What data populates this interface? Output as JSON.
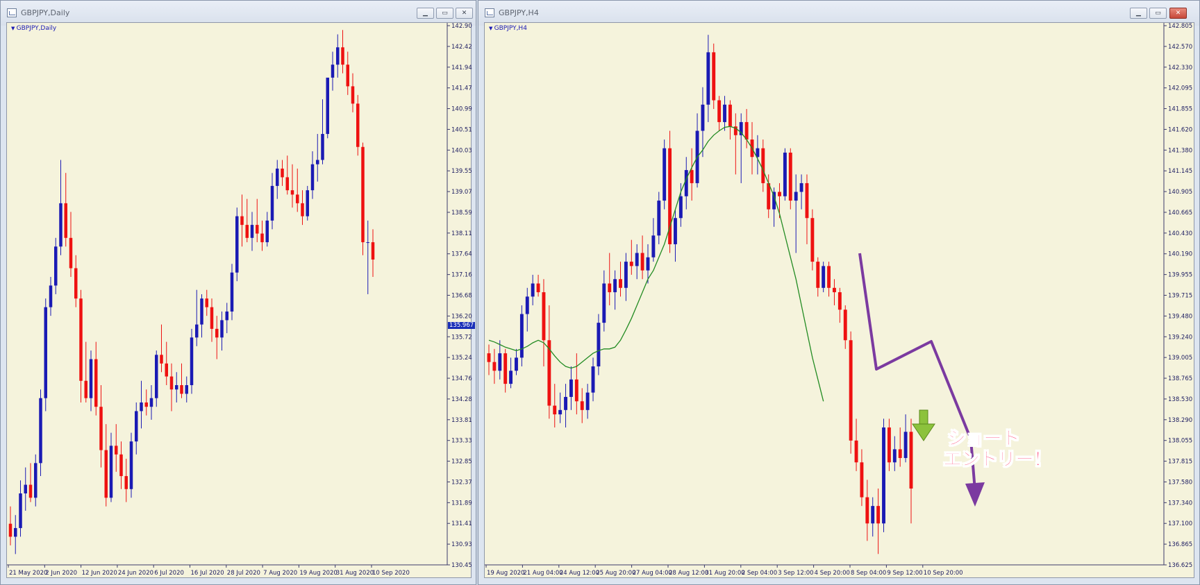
{
  "left_window": {
    "title": "GBPJPY,Daily",
    "symbol_label": "GBPJPY,Daily",
    "current_price": "135.967",
    "buttons": [
      "minimize",
      "maximize",
      "close"
    ]
  },
  "right_window": {
    "title": "GBPJPY,H4",
    "symbol_label": "GBPJPY,H4",
    "buttons": [
      "minimize",
      "maximize",
      "close"
    ],
    "annotation_line1": "ショート",
    "annotation_line2": "エントリー！"
  },
  "colors": {
    "bull": "#1a1ab4",
    "bear": "#ee1111",
    "ma": "#228b22",
    "annotation_arrow": "#7b3aa0",
    "down_arrow": "#8cc23c",
    "background": "#f5f3dc"
  },
  "chart_data": [
    {
      "type": "candlestick",
      "title": "GBPJPY,Daily",
      "ylim": [
        130.45,
        142.9
      ],
      "y_ticks": [
        "142.900",
        "142.420",
        "141.940",
        "141.470",
        "140.990",
        "140.510",
        "140.030",
        "139.550",
        "139.070",
        "138.590",
        "138.110",
        "137.640",
        "137.160",
        "136.680",
        "136.200",
        "135.720",
        "135.240",
        "134.760",
        "134.280",
        "133.810",
        "133.330",
        "132.850",
        "132.370",
        "131.890",
        "131.410",
        "130.930",
        "130.450"
      ],
      "x_ticks": [
        "21 May 2020",
        "2 Jun 2020",
        "12 Jun 2020",
        "24 Jun 2020",
        "6 Jul 2020",
        "16 Jul 2020",
        "28 Jul 2020",
        "7 Aug 2020",
        "19 Aug 2020",
        "31 Aug 2020",
        "10 Sep 2020"
      ],
      "candles": [
        [
          131.4,
          131.8,
          130.9,
          131.1
        ],
        [
          131.1,
          131.6,
          130.7,
          131.3
        ],
        [
          131.3,
          132.4,
          131.1,
          132.1
        ],
        [
          132.1,
          132.7,
          131.7,
          132.3
        ],
        [
          132.3,
          132.8,
          131.9,
          132.0
        ],
        [
          132.0,
          133.0,
          131.8,
          132.8
        ],
        [
          132.8,
          134.5,
          132.5,
          134.3
        ],
        [
          134.3,
          136.6,
          134.0,
          136.4
        ],
        [
          136.4,
          137.1,
          136.2,
          136.9
        ],
        [
          136.9,
          138.0,
          136.7,
          137.8
        ],
        [
          137.8,
          139.8,
          137.6,
          138.8
        ],
        [
          138.8,
          139.5,
          137.8,
          138.0
        ],
        [
          138.0,
          138.6,
          137.1,
          137.3
        ],
        [
          137.3,
          137.6,
          136.4,
          136.6
        ],
        [
          136.6,
          136.8,
          134.2,
          134.7
        ],
        [
          134.7,
          135.6,
          134.2,
          134.3
        ],
        [
          134.3,
          135.4,
          134.0,
          135.2
        ],
        [
          135.2,
          135.6,
          133.9,
          134.1
        ],
        [
          134.1,
          134.6,
          132.7,
          133.1
        ],
        [
          133.1,
          133.7,
          131.8,
          132.0
        ],
        [
          132.0,
          133.5,
          131.9,
          133.2
        ],
        [
          133.2,
          133.7,
          132.6,
          133.0
        ],
        [
          133.0,
          133.3,
          132.2,
          132.5
        ],
        [
          132.5,
          132.9,
          131.9,
          132.2
        ],
        [
          132.2,
          133.5,
          132.0,
          133.3
        ],
        [
          133.3,
          134.2,
          133.0,
          134.0
        ],
        [
          134.0,
          134.7,
          133.6,
          134.2
        ],
        [
          134.2,
          134.5,
          133.9,
          134.1
        ],
        [
          134.1,
          134.6,
          133.8,
          134.3
        ],
        [
          134.3,
          135.4,
          134.1,
          135.3
        ],
        [
          135.3,
          136.0,
          134.9,
          135.1
        ],
        [
          135.1,
          135.6,
          134.6,
          134.8
        ],
        [
          134.8,
          135.1,
          134.0,
          134.5
        ],
        [
          134.5,
          134.9,
          134.2,
          134.6
        ],
        [
          134.6,
          135.1,
          134.3,
          134.4
        ],
        [
          134.4,
          134.8,
          134.2,
          134.6
        ],
        [
          134.6,
          135.9,
          134.4,
          135.7
        ],
        [
          135.7,
          136.8,
          135.5,
          136.0
        ],
        [
          136.0,
          136.7,
          135.7,
          136.6
        ],
        [
          136.6,
          136.8,
          136.2,
          136.4
        ],
        [
          136.4,
          136.6,
          135.6,
          135.9
        ],
        [
          135.9,
          136.2,
          135.2,
          135.7
        ],
        [
          135.7,
          136.3,
          135.4,
          136.1
        ],
        [
          136.1,
          136.5,
          135.8,
          136.3
        ],
        [
          136.3,
          137.4,
          136.1,
          137.2
        ],
        [
          137.2,
          138.7,
          137.0,
          138.5
        ],
        [
          138.5,
          139.0,
          137.8,
          138.3
        ],
        [
          138.3,
          138.9,
          137.9,
          138.0
        ],
        [
          138.0,
          138.6,
          137.7,
          138.3
        ],
        [
          138.3,
          138.9,
          137.9,
          138.1
        ],
        [
          138.1,
          138.4,
          137.7,
          137.9
        ],
        [
          137.9,
          138.6,
          137.8,
          138.4
        ],
        [
          138.4,
          139.5,
          138.2,
          139.2
        ],
        [
          139.2,
          139.8,
          138.9,
          139.6
        ],
        [
          139.6,
          139.8,
          139.2,
          139.4
        ],
        [
          139.4,
          139.9,
          139.0,
          139.1
        ],
        [
          139.1,
          139.7,
          138.7,
          139.0
        ],
        [
          139.0,
          139.6,
          138.6,
          138.8
        ],
        [
          138.8,
          139.1,
          138.3,
          138.5
        ],
        [
          138.5,
          139.2,
          138.4,
          139.1
        ],
        [
          139.1,
          140.0,
          138.9,
          139.7
        ],
        [
          139.7,
          140.4,
          139.3,
          139.8
        ],
        [
          139.8,
          141.2,
          139.7,
          140.4
        ],
        [
          140.4,
          141.6,
          140.3,
          141.7
        ],
        [
          141.7,
          142.3,
          141.4,
          142.0
        ],
        [
          142.0,
          142.7,
          141.7,
          142.4
        ],
        [
          142.4,
          142.8,
          141.8,
          142.0
        ],
        [
          142.0,
          142.3,
          141.3,
          141.5
        ],
        [
          141.5,
          141.8,
          140.9,
          141.1
        ],
        [
          141.1,
          141.3,
          139.9,
          140.1
        ],
        [
          140.1,
          140.2,
          137.6,
          137.9
        ],
        [
          137.9,
          138.4,
          136.7,
          137.9
        ],
        [
          137.9,
          138.2,
          137.1,
          137.5
        ]
      ]
    },
    {
      "type": "candlestick",
      "title": "GBPJPY,H4",
      "ylim": [
        136.625,
        142.805
      ],
      "y_ticks": [
        "142.805",
        "142.570",
        "142.330",
        "142.095",
        "141.855",
        "141.620",
        "141.380",
        "141.145",
        "140.905",
        "140.665",
        "140.430",
        "140.190",
        "139.955",
        "139.715",
        "139.480",
        "139.240",
        "139.005",
        "138.765",
        "138.530",
        "138.290",
        "138.055",
        "137.815",
        "137.580",
        "137.340",
        "137.100",
        "136.865",
        "136.625"
      ],
      "x_ticks": [
        "19 Aug 2020",
        "21 Aug 04:00",
        "24 Aug 12:00",
        "25 Aug 20:00",
        "27 Aug 04:00",
        "28 Aug 12:00",
        "31 Aug 20:00",
        "2 Sep 04:00",
        "3 Sep 12:00",
        "4 Sep 20:00",
        "8 Sep 04:00",
        "9 Sep 12:00",
        "10 Sep 20:00"
      ],
      "candles": [
        [
          139.05,
          139.15,
          138.8,
          138.95
        ],
        [
          138.95,
          139.1,
          138.7,
          138.85
        ],
        [
          138.85,
          139.2,
          138.75,
          139.05
        ],
        [
          139.05,
          139.1,
          138.6,
          138.7
        ],
        [
          138.7,
          139.0,
          138.65,
          138.85
        ],
        [
          138.85,
          139.1,
          138.8,
          139.0
        ],
        [
          139.0,
          139.6,
          138.9,
          139.5
        ],
        [
          139.5,
          139.8,
          139.3,
          139.7
        ],
        [
          139.7,
          139.95,
          139.6,
          139.85
        ],
        [
          139.85,
          139.95,
          139.7,
          139.75
        ],
        [
          139.75,
          139.9,
          138.9,
          139.2
        ],
        [
          139.2,
          139.6,
          138.3,
          138.45
        ],
        [
          138.45,
          138.7,
          138.2,
          138.35
        ],
        [
          138.35,
          138.6,
          138.25,
          138.4
        ],
        [
          138.4,
          138.7,
          138.2,
          138.55
        ],
        [
          138.55,
          138.9,
          138.4,
          138.75
        ],
        [
          138.75,
          139.05,
          138.35,
          138.5
        ],
        [
          138.5,
          138.65,
          138.25,
          138.4
        ],
        [
          138.4,
          138.7,
          138.3,
          138.6
        ],
        [
          138.6,
          139.0,
          138.5,
          138.9
        ],
        [
          138.9,
          139.5,
          138.8,
          139.4
        ],
        [
          139.4,
          140.0,
          139.3,
          139.85
        ],
        [
          139.85,
          140.2,
          139.6,
          139.75
        ],
        [
          139.75,
          140.0,
          139.55,
          139.9
        ],
        [
          139.9,
          140.1,
          139.7,
          139.8
        ],
        [
          139.8,
          140.2,
          139.65,
          140.1
        ],
        [
          140.1,
          140.35,
          139.95,
          140.05
        ],
        [
          140.05,
          140.3,
          139.9,
          140.2
        ],
        [
          140.2,
          140.4,
          139.9,
          140.0
        ],
        [
          140.0,
          140.3,
          139.85,
          140.15
        ],
        [
          140.15,
          140.6,
          140.1,
          140.4
        ],
        [
          140.4,
          140.9,
          140.3,
          140.8
        ],
        [
          140.8,
          141.5,
          140.7,
          141.4
        ],
        [
          141.4,
          141.6,
          140.2,
          140.3
        ],
        [
          140.3,
          140.7,
          140.1,
          140.6
        ],
        [
          140.6,
          141.0,
          140.5,
          140.85
        ],
        [
          140.85,
          141.3,
          140.7,
          141.15
        ],
        [
          141.15,
          141.4,
          140.8,
          141.0
        ],
        [
          141.0,
          141.8,
          140.95,
          141.6
        ],
        [
          141.6,
          142.1,
          141.3,
          141.9
        ],
        [
          141.9,
          142.7,
          141.7,
          142.5
        ],
        [
          142.5,
          142.6,
          141.85,
          141.95
        ],
        [
          141.95,
          142.0,
          141.6,
          141.7
        ],
        [
          141.7,
          142.0,
          141.6,
          141.9
        ],
        [
          141.9,
          141.95,
          141.5,
          141.65
        ],
        [
          141.65,
          141.8,
          141.1,
          141.55
        ],
        [
          141.55,
          141.8,
          141.0,
          141.7
        ],
        [
          141.7,
          141.85,
          141.4,
          141.5
        ],
        [
          141.5,
          141.7,
          141.1,
          141.3
        ],
        [
          141.3,
          141.55,
          141.1,
          141.4
        ],
        [
          141.4,
          141.5,
          140.9,
          141.0
        ],
        [
          141.0,
          141.1,
          140.6,
          140.7
        ],
        [
          140.7,
          140.95,
          140.5,
          140.9
        ],
        [
          140.9,
          141.0,
          140.6,
          140.85
        ],
        [
          140.85,
          141.4,
          140.8,
          141.35
        ],
        [
          141.35,
          141.4,
          140.7,
          140.8
        ],
        [
          140.8,
          141.1,
          140.2,
          140.9
        ],
        [
          140.9,
          141.1,
          140.7,
          141.0
        ],
        [
          141.0,
          141.1,
          140.3,
          140.6
        ],
        [
          140.6,
          140.7,
          140.0,
          140.1
        ],
        [
          140.1,
          140.15,
          139.7,
          139.8
        ],
        [
          139.8,
          140.1,
          139.75,
          140.05
        ],
        [
          140.05,
          140.1,
          139.7,
          139.8
        ],
        [
          139.8,
          139.9,
          139.6,
          139.75
        ],
        [
          139.75,
          139.8,
          139.4,
          139.55
        ],
        [
          139.55,
          139.6,
          139.1,
          139.2
        ],
        [
          139.2,
          139.3,
          137.9,
          138.05
        ],
        [
          138.05,
          138.3,
          137.7,
          137.8
        ],
        [
          137.8,
          137.95,
          137.3,
          137.4
        ],
        [
          137.4,
          137.6,
          136.9,
          137.1
        ],
        [
          137.1,
          137.4,
          136.95,
          137.3
        ],
        [
          137.3,
          137.5,
          136.75,
          137.1
        ],
        [
          137.1,
          138.3,
          137.0,
          138.2
        ],
        [
          138.2,
          138.3,
          137.7,
          137.8
        ],
        [
          137.8,
          138.1,
          137.7,
          137.95
        ],
        [
          137.95,
          138.2,
          137.75,
          137.85
        ],
        [
          137.85,
          138.35,
          137.8,
          138.15
        ],
        [
          138.15,
          138.3,
          137.1,
          137.5
        ]
      ],
      "ma_series": [
        139.2,
        139.18,
        139.15,
        139.12,
        139.1,
        139.08,
        139.1,
        139.13,
        139.17,
        139.2,
        139.17,
        139.1,
        139.02,
        138.95,
        138.9,
        138.88,
        138.9,
        138.95,
        139.0,
        139.05,
        139.08,
        139.1,
        139.1,
        139.12,
        139.2,
        139.32,
        139.45,
        139.6,
        139.75,
        139.9,
        140.0,
        140.15,
        140.3,
        140.5,
        140.7,
        140.9,
        141.05,
        141.18,
        141.3,
        141.38,
        141.48,
        141.55,
        141.6,
        141.64,
        141.65,
        141.63,
        141.58,
        141.5,
        141.4,
        141.28,
        141.15,
        141.0,
        140.85,
        140.65,
        140.4,
        140.15,
        139.9,
        139.6,
        139.3,
        139.0,
        138.75,
        138.5
      ]
    }
  ]
}
